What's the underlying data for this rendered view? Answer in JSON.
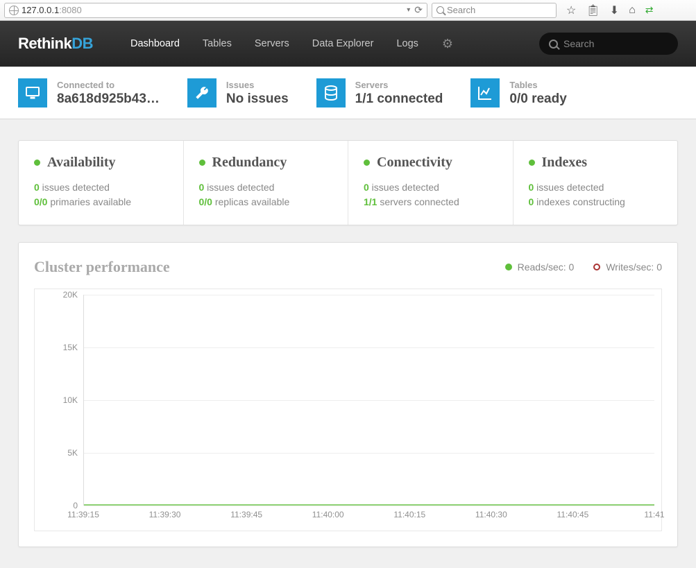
{
  "browser": {
    "url_host": "127.0.0.1",
    "url_port": ":8080",
    "search_placeholder": "Search"
  },
  "nav": {
    "logo_a": "Rethink",
    "logo_b": "DB",
    "links": [
      "Dashboard",
      "Tables",
      "Servers",
      "Data Explorer",
      "Logs"
    ],
    "active": 0,
    "search_placeholder": "Search"
  },
  "status": {
    "connected": {
      "label": "Connected to",
      "value": "8a618d925b43…"
    },
    "issues": {
      "label": "Issues",
      "value": "No issues"
    },
    "servers": {
      "label": "Servers",
      "value": "1/1 connected"
    },
    "tables": {
      "label": "Tables",
      "value": "0/0 ready"
    }
  },
  "cards": {
    "availability": {
      "title": "Availability",
      "l1_num": "0",
      "l1_txt": " issues detected",
      "l2_num": "0/0",
      "l2_txt": " primaries available"
    },
    "redundancy": {
      "title": "Redundancy",
      "l1_num": "0",
      "l1_txt": " issues detected",
      "l2_num": "0/0",
      "l2_txt": " replicas available"
    },
    "connectivity": {
      "title": "Connectivity",
      "l1_num": "0",
      "l1_txt": " issues detected",
      "l2_num": "1/1",
      "l2_txt": " servers connected"
    },
    "indexes": {
      "title": "Indexes",
      "l1_num": "0",
      "l1_txt": " issues detected",
      "l2_num": "0",
      "l2_txt": " indexes constructing"
    }
  },
  "perf": {
    "title": "Cluster performance",
    "legend_reads": "Reads/sec: 0",
    "legend_writes": "Writes/sec: 0"
  },
  "chart_data": {
    "type": "line",
    "title": "Cluster performance",
    "xlabel": "",
    "ylabel": "",
    "ylim": [
      0,
      20000
    ],
    "y_ticks": [
      "20K",
      "15K",
      "10K",
      "5K",
      "0"
    ],
    "x_ticks": [
      "11:39:15",
      "11:39:30",
      "11:39:45",
      "11:40:00",
      "11:40:15",
      "11:40:30",
      "11:40:45",
      "11:41"
    ],
    "series": [
      {
        "name": "Reads/sec",
        "values": [
          0,
          0,
          0,
          0,
          0,
          0,
          0,
          0
        ]
      },
      {
        "name": "Writes/sec",
        "values": [
          0,
          0,
          0,
          0,
          0,
          0,
          0,
          0
        ]
      }
    ]
  }
}
